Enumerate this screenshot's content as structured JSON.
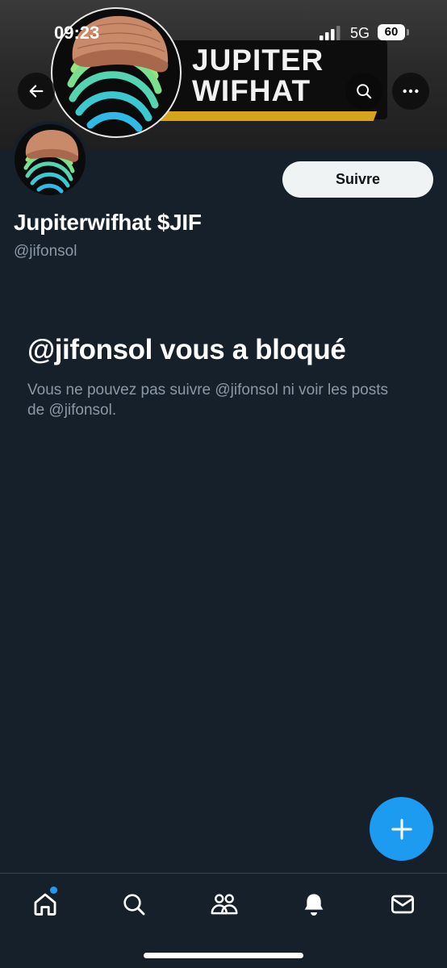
{
  "status_bar": {
    "time": "09:23",
    "network": "5G",
    "battery": "60"
  },
  "banner": {
    "title_line1": "JUPITER",
    "title_line2": "WIFHAT"
  },
  "header": {
    "back_icon": "arrow-left-icon",
    "search_icon": "search-icon",
    "more_icon": "more-horizontal-icon"
  },
  "profile": {
    "display_name": "Jupiterwifhat $JIF",
    "handle": "@jifonsol",
    "follow_label": "Suivre"
  },
  "blocked": {
    "title": "@jifonsol vous a bloqué",
    "description": "Vous ne pouvez pas suivre @jifonsol ni voir les posts de @jifonsol."
  },
  "fab": {
    "icon": "plus-icon"
  },
  "bottom_nav": {
    "items": [
      "home-icon",
      "search-icon",
      "communities-icon",
      "notifications-icon",
      "messages-icon"
    ]
  },
  "colors": {
    "background": "#15202b",
    "accent": "#1d9bf0",
    "secondary_text": "#8b98a5",
    "banner_gold": "#d9a21b"
  }
}
